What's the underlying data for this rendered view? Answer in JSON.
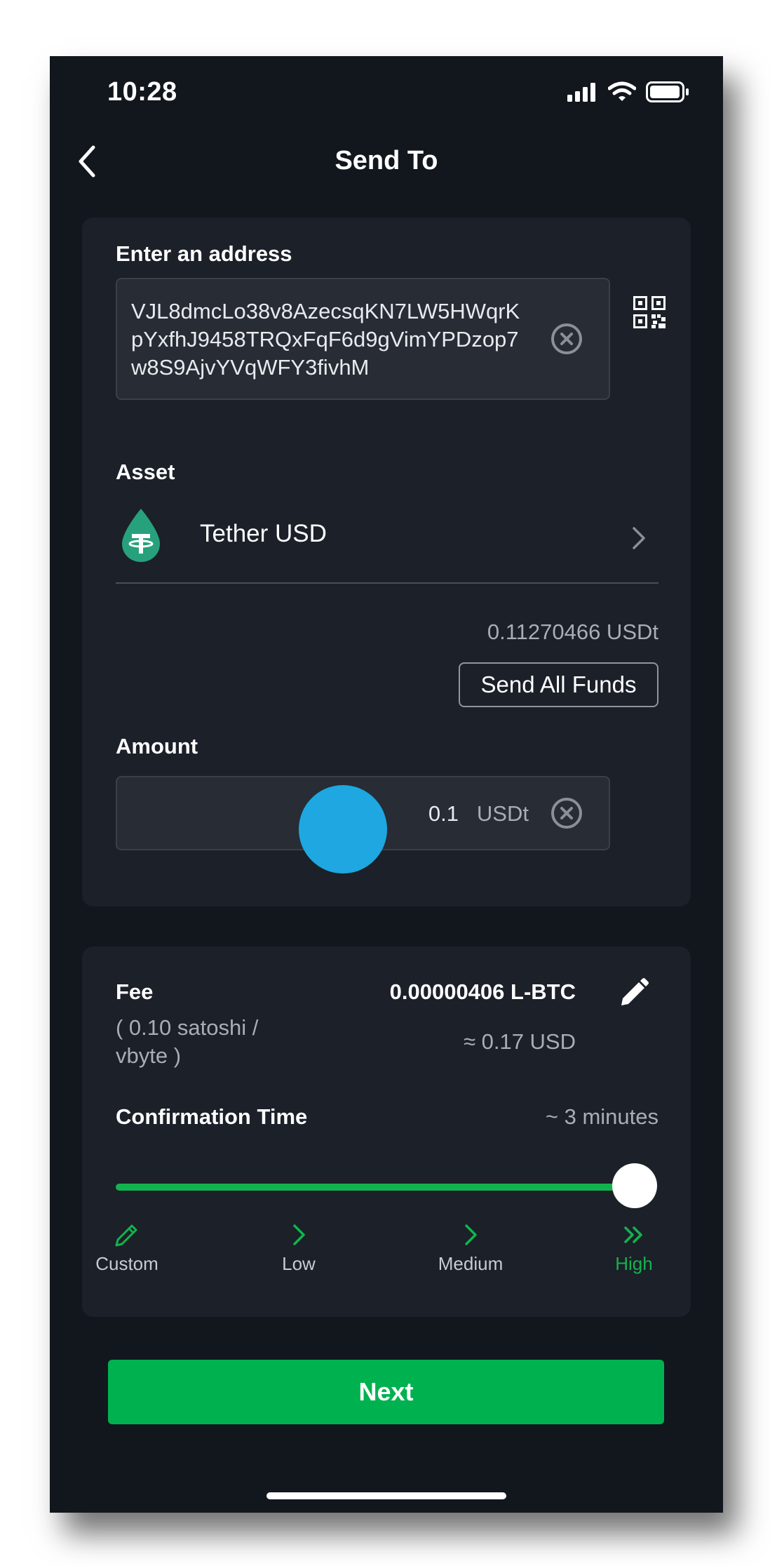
{
  "status_bar": {
    "time": "10:28"
  },
  "header": {
    "title": "Send To"
  },
  "address": {
    "label": "Enter an address",
    "value": "VJL8dmcLo38v8AzecsqKN7LW5HWqrKpYxfhJ9458TRQxFqF6d9gVimYPDzop7w8S9AjvYVqWFY3fivhM"
  },
  "asset": {
    "label": "Asset",
    "name": "Tether USD",
    "icon": "tether-icon",
    "balance": "0.11270466 USDt",
    "send_all_label": "Send All Funds"
  },
  "amount": {
    "label": "Amount",
    "value": "0.1",
    "unit": "USDt"
  },
  "fee": {
    "label": "Fee",
    "rate": "( 0.10 satoshi / vbyte )",
    "amount": "0.00000406 L-BTC",
    "usd": "≈ 0.17 USD"
  },
  "confirmation": {
    "label": "Confirmation Time",
    "estimate": "~ 3 minutes",
    "options": [
      {
        "label": "Custom",
        "icon": "pencil-icon"
      },
      {
        "label": "Low",
        "icon": "chevron-right-icon"
      },
      {
        "label": "Medium",
        "icon": "chevron-right-icon"
      },
      {
        "label": "High",
        "icon": "double-chevron-right-icon"
      }
    ],
    "selected": "High"
  },
  "next_label": "Next",
  "colors": {
    "accent": "#00b24f",
    "background": "#12171e",
    "card": "#1b2029",
    "touch": "#1ea7e1"
  }
}
